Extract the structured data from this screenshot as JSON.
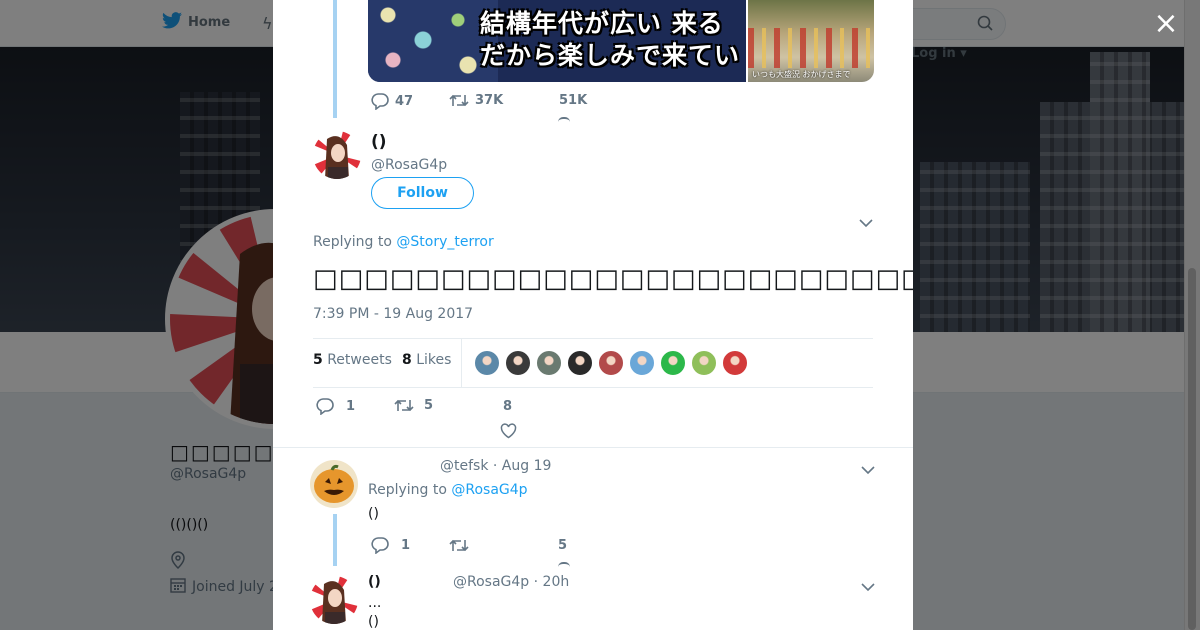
{
  "nav": {
    "home_label": "Home",
    "login_label": "Log in"
  },
  "profile": {
    "name": "□□□□□□□(□",
    "handle": "@RosaG4p",
    "bio": "(()()()",
    "joined": "Joined July 2"
  },
  "modal": {
    "close_symbol": "×",
    "media": {
      "caption_line1": "結構年代が広い 来る",
      "caption_line2": "だから楽しみで来てい",
      "side_caption": "いつも大盛況 おかげさまで"
    },
    "prev_tweet_actions": {
      "replies": "47",
      "retweets": "37K",
      "likes": "51K"
    },
    "main_tweet": {
      "name": "()",
      "handle": "@RosaG4p",
      "follow_label": "Follow",
      "replying_prefix": "Replying to ",
      "replying_to": "@Story_terror",
      "text": "□□□□□□□□□□□□□□□□□□□□□□□□□□□□□□□□□□□□□□□□□□□□□□□□□",
      "timestamp": "7:39 PM - 19 Aug 2017",
      "retweets_count": "5",
      "retweets_label": "Retweets",
      "likes_count": "8",
      "likes_label": "Likes",
      "actions": {
        "replies": "1",
        "retweets": "5",
        "likes": "8"
      },
      "liker_colors": [
        "#5b88a8",
        "#3a3a3a",
        "#6a7a70",
        "#2a2a2a",
        "#b24a4a",
        "#6aa7d8",
        "#2cb84a",
        "#8fbf5a",
        "#d23a3a"
      ]
    },
    "replies": [
      {
        "handle": "@tefsk",
        "time": "Aug 19",
        "replying_prefix": "Replying to ",
        "replying_to": "@RosaG4p",
        "text": "()",
        "actions": {
          "replies": "1",
          "retweets": "",
          "likes": "5"
        }
      },
      {
        "name": "()",
        "handle": "@RosaG4p",
        "time": "20h",
        "line1": "...",
        "line2": "()"
      }
    ]
  },
  "colors": {
    "accent": "#1da1f2",
    "text_secondary": "#657786",
    "thread_line": "#a6d2f2"
  },
  "icons": [
    "twitter-bird-icon",
    "search-icon",
    "location-icon",
    "calendar-icon",
    "close-icon",
    "reply-icon",
    "retweet-icon",
    "heart-icon",
    "chevron-down-icon"
  ]
}
